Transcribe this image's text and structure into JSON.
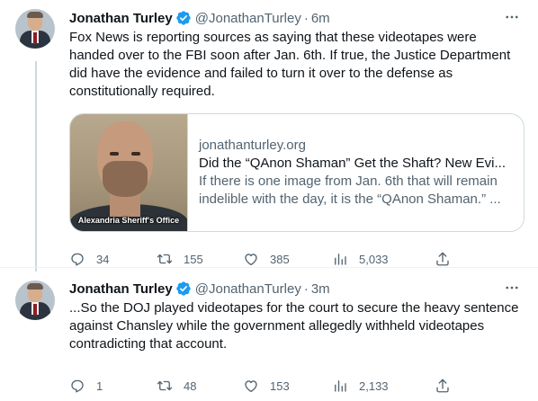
{
  "tweets": [
    {
      "author_name": "Jonathan Turley",
      "handle": "@JonathanTurley",
      "separator": "·",
      "time": "6m",
      "text": "Fox News is reporting sources as saying that these videotapes were handed over to the FBI soon after Jan. 6th. If true, the Justice Department did have the evidence and failed to turn it over to the defense as constitutionally required.",
      "card": {
        "domain": "jonathanturley.org",
        "title": "Did the “QAnon Shaman” Get the Shaft? New Evi...",
        "description": "If there is one image from Jan. 6th that will remain indelible with the day, it is the “QAnon Shaman.” ...",
        "image_caption": "Alexandria Sheriff's Office"
      },
      "actions": {
        "replies": "34",
        "retweets": "155",
        "likes": "385",
        "views": "5,033"
      }
    },
    {
      "author_name": "Jonathan Turley",
      "handle": "@JonathanTurley",
      "separator": "·",
      "time": "3m",
      "text": "...So the DOJ played videotapes for the court to secure the heavy sentence against Chansley while the government allegedly withheld videotapes contradicting that account.",
      "actions": {
        "replies": "1",
        "retweets": "48",
        "likes": "153",
        "views": "2,133"
      }
    }
  ],
  "icons": {
    "verified": "verified-badge-icon",
    "more": "more-horizontal-icon",
    "reply": "reply-icon",
    "retweet": "retweet-icon",
    "like": "heart-icon",
    "views": "views-chart-icon",
    "share": "share-icon"
  },
  "colors": {
    "accent": "#1d9bf0",
    "text": "#0f1419",
    "secondary": "#536471",
    "border": "#cfd9de"
  }
}
